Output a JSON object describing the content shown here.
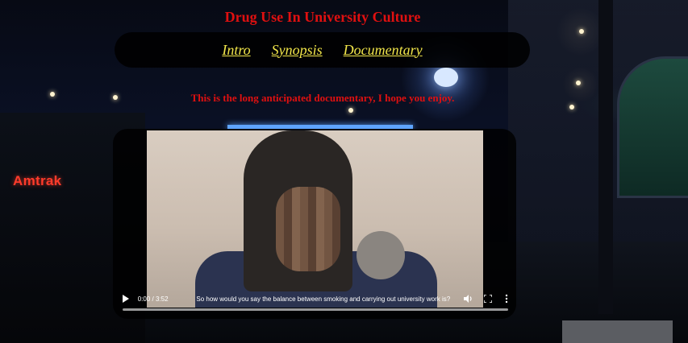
{
  "header": {
    "title": "Drug Use In University Culture"
  },
  "nav": {
    "items": [
      {
        "label": "Intro"
      },
      {
        "label": "Synopsis"
      },
      {
        "label": "Documentary"
      }
    ]
  },
  "main": {
    "tagline": "This is the long anticipated documentary, I hope you enjoy."
  },
  "background": {
    "sign_text": "Amtrak"
  },
  "video": {
    "time_display": "0:00 / 3:52",
    "caption": "So how would you say the balance between smoking and carrying out university work is?",
    "progress": 0.0,
    "icons": {
      "play": "play-icon",
      "volume": "volume-icon",
      "fullscreen": "fullscreen-icon",
      "more": "more-options-icon"
    }
  },
  "colors": {
    "title_red": "#e01010",
    "nav_yellow": "#f2e64a",
    "nav_bg": "#000000"
  }
}
